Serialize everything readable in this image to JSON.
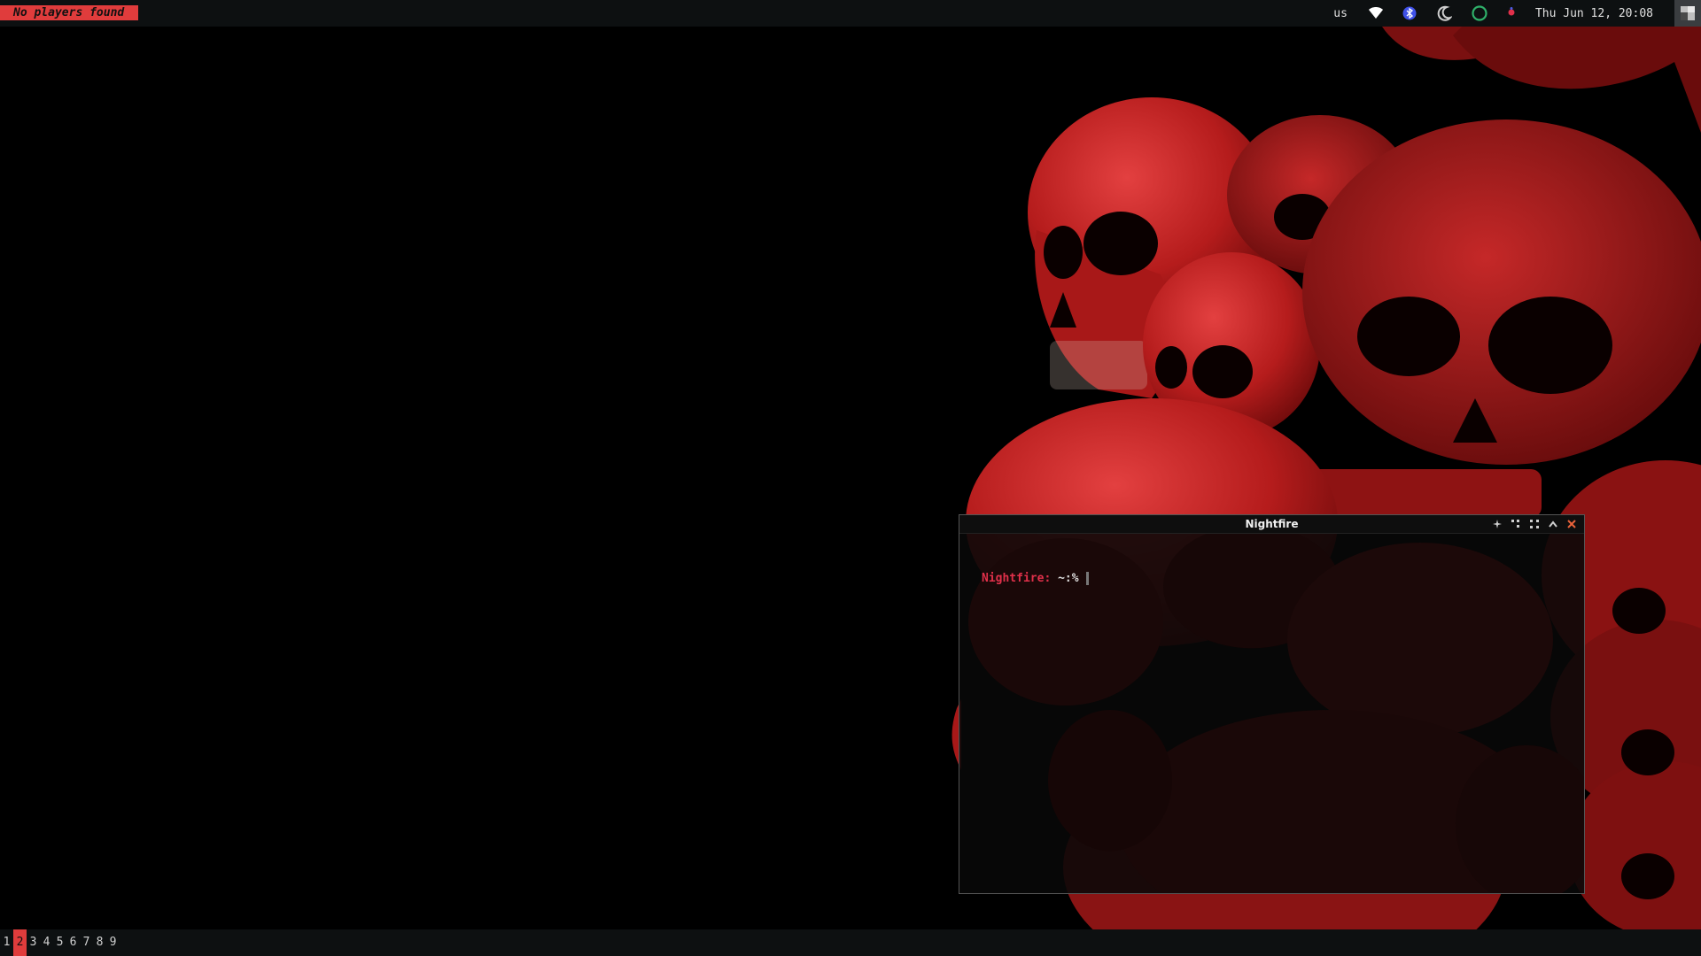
{
  "topbar": {
    "media_status": "No players found",
    "keyboard_layout": "us",
    "clock": "Thu Jun 12, 20:08",
    "tray_icons": [
      "wifi-icon",
      "bluetooth-icon",
      "night-light-icon",
      "power-ring-icon",
      "notification-dot-icon"
    ],
    "accent_color": "#e03c3c"
  },
  "workspaces": {
    "items": [
      "1",
      "2",
      "3",
      "4",
      "5",
      "6",
      "7",
      "8",
      "9"
    ],
    "active": "2"
  },
  "terminal": {
    "title": "Nightfire",
    "prompt_host": "Nightfire:",
    "prompt_path": " ~:%",
    "buttons": [
      "pin-icon",
      "shrink-icon",
      "maximize-icon",
      "minimize-icon",
      "close-icon"
    ]
  },
  "wallpaper": {
    "subject": "skull-wallpaper",
    "color": "#c0201f"
  }
}
